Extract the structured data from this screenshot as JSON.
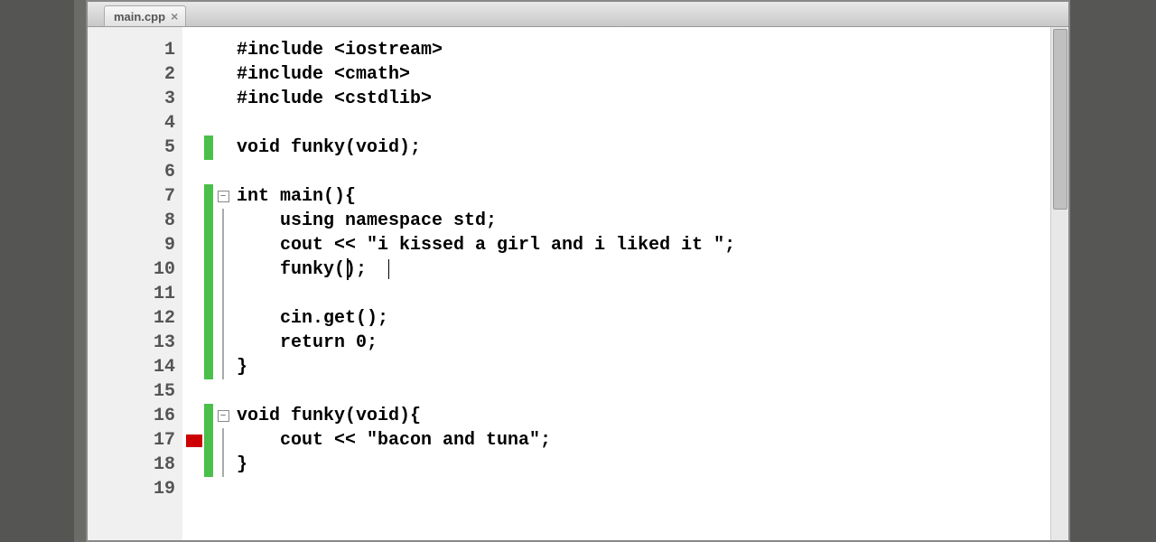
{
  "tab": {
    "filename": "main.cpp",
    "close": "×"
  },
  "lineNumbers": [
    "1",
    "2",
    "3",
    "4",
    "5",
    "6",
    "7",
    "8",
    "9",
    "10",
    "11",
    "12",
    "13",
    "14",
    "15",
    "16",
    "17",
    "18",
    "19"
  ],
  "code": {
    "lines": [
      "#include <iostream>",
      "#include <cmath>",
      "#include <cstdlib>",
      "",
      "void funky(void);",
      "",
      "int main(){",
      "    using namespace std;",
      "    cout << \"i kissed a girl and i liked it \";",
      "    funky();",
      "",
      "    cin.get();",
      "    return 0;",
      "}",
      "",
      "void funky(void){",
      "    cout << \"bacon and tuna\";",
      "}",
      ""
    ]
  },
  "markers": {
    "errorLine": 17,
    "changedLines": [
      5,
      7,
      8,
      9,
      10,
      11,
      12,
      13,
      14,
      16,
      17,
      18
    ],
    "foldStarts": [
      7,
      16
    ],
    "foldLines": [
      8,
      9,
      10,
      11,
      12,
      13,
      14,
      17,
      18
    ]
  },
  "cursorLine": 10,
  "cursorColOffset": "122px",
  "caretOffset": "168px"
}
